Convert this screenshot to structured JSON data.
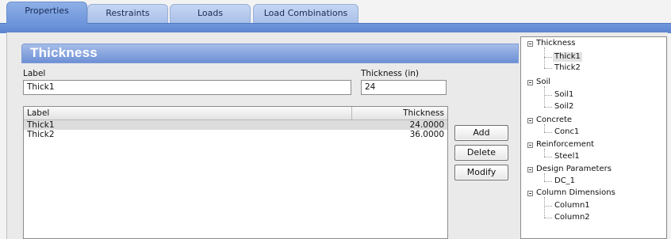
{
  "tabs": [
    {
      "label": "Properties",
      "active": true
    },
    {
      "label": "Restraints",
      "active": false
    },
    {
      "label": "Loads",
      "active": false
    },
    {
      "label": "Load Combinations",
      "active": false
    }
  ],
  "section": {
    "title": "Thickness"
  },
  "form": {
    "label_caption": "Label",
    "label_value": "Thick1",
    "thickness_caption": "Thickness (in)",
    "thickness_value": "24"
  },
  "table": {
    "columns": [
      "Label",
      "Thickness"
    ],
    "rows": [
      {
        "label": "Thick1",
        "thickness": "24.0000",
        "selected": true
      },
      {
        "label": "Thick2",
        "thickness": "36.0000",
        "selected": false
      }
    ]
  },
  "buttons": {
    "add": "Add",
    "delete": "Delete",
    "modify": "Modify"
  },
  "tree": [
    {
      "label": "Thickness",
      "children": [
        "Thick1",
        "Thick2"
      ]
    },
    {
      "label": "Soil",
      "children": [
        "Soil1",
        "Soil2"
      ]
    },
    {
      "label": "Concrete",
      "children": [
        "Conc1"
      ]
    },
    {
      "label": "Reinforcement",
      "children": [
        "Steel1"
      ]
    },
    {
      "label": "Design Parameters",
      "children": [
        "DC_1"
      ]
    },
    {
      "label": "Column Dimensions",
      "children": [
        "Column1",
        "Column2"
      ]
    }
  ],
  "tree_selected": "Thick1",
  "colors": {
    "tab_active": "#7fa2e0",
    "tab_inactive": "#b9cdf0",
    "heading": "#7b9bdb"
  }
}
